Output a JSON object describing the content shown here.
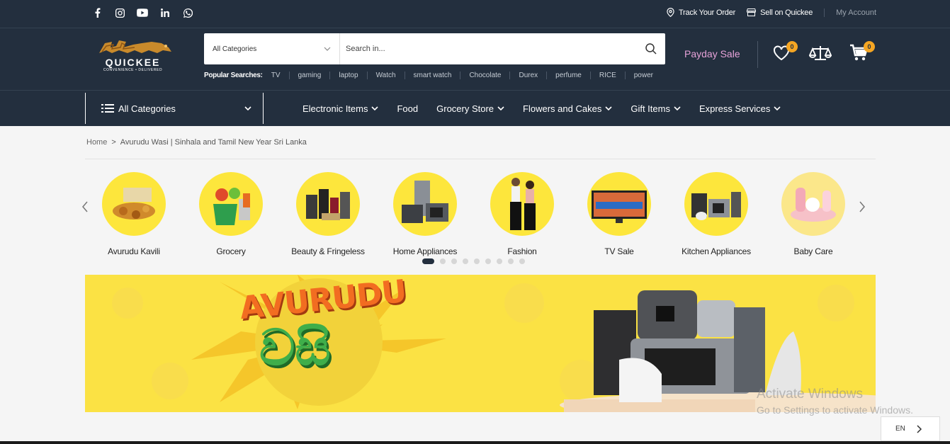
{
  "topbar": {
    "social_icons": [
      "facebook-icon",
      "instagram-icon",
      "youtube-icon",
      "linkedin-icon",
      "whatsapp-icon"
    ],
    "track_order": "Track Your Order",
    "sell": "Sell on Quickee",
    "account": "My Account"
  },
  "logo": {
    "name": "QUICKEE",
    "tagline": "CONVENIENCE • DELIVERED"
  },
  "search": {
    "category": "All Categories",
    "placeholder": "Search in..."
  },
  "popular": {
    "label": "Popular Searches:",
    "items": [
      "TV",
      "gaming",
      "laptop",
      "Watch",
      "smart watch",
      "Chocolate",
      "Durex",
      "perfume",
      "RICE",
      "power"
    ]
  },
  "header": {
    "promo": "Payday Sale",
    "wishlist_count": "0",
    "cart_count": "0"
  },
  "nav": {
    "all_categories": "All Categories",
    "items": [
      {
        "label": "Electronic Items"
      },
      {
        "label": "Food"
      },
      {
        "label": "Grocery Store"
      },
      {
        "label": "Flowers and Cakes"
      },
      {
        "label": "Gift Items"
      },
      {
        "label": "Express Services"
      }
    ]
  },
  "breadcrumb": {
    "home": "Home",
    "sep": ">",
    "current": "Avurudu Wasi | Sinhala and Tamil New Year Sri Lanka"
  },
  "categories": [
    {
      "name": "Avurudu Kavili"
    },
    {
      "name": "Grocery"
    },
    {
      "name": "Beauty & Fringeless"
    },
    {
      "name": "Home Appliances"
    },
    {
      "name": "Fashion"
    },
    {
      "name": "TV Sale"
    },
    {
      "name": "Kitchen Appliances"
    },
    {
      "name": "Baby Care"
    }
  ],
  "carousel": {
    "dot_count": 9,
    "active_index": 0
  },
  "banner": {
    "line1": "AVURUDU",
    "line2": "වසි"
  },
  "watermark": {
    "title": "Activate Windows",
    "subtitle": "Go to Settings to activate Windows."
  },
  "language": "EN",
  "colors": {
    "header_bg": "#232f3e",
    "accent": "#f5a623",
    "promo": "#e6a2d8",
    "category_circle": "#fde63c",
    "banner_bg": "#fbe244"
  }
}
